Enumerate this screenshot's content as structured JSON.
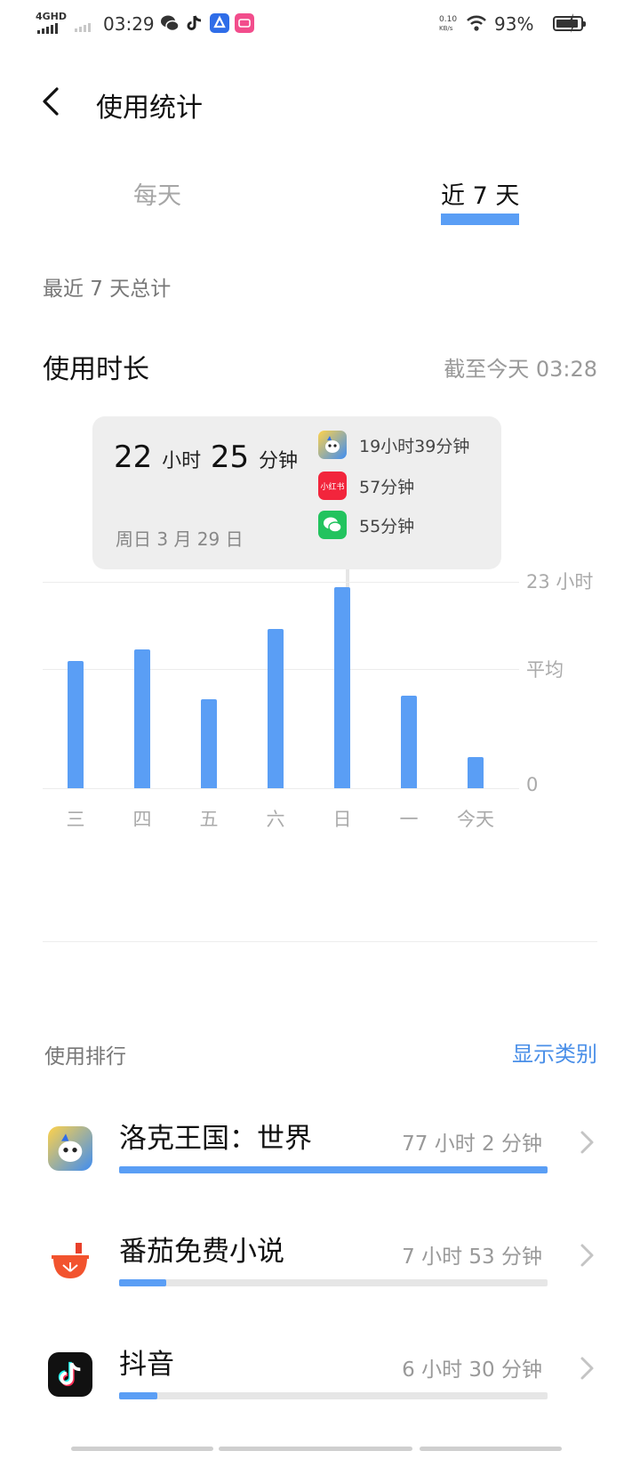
{
  "status_bar": {
    "network": "4GHD",
    "time": "03:29",
    "speed_value": "0.10",
    "speed_unit": "KB/s",
    "battery": "93%",
    "battery_level": 0.93
  },
  "header": {
    "title": "使用统计",
    "back_icon": "chevron-left-icon"
  },
  "tabs": [
    {
      "label": "每天",
      "active": false
    },
    {
      "label": "近 7 天",
      "active": true
    }
  ],
  "summary": {
    "caption": "最近 7 天总计",
    "usage_title": "使用时长",
    "as_of": "截至今天 03:28"
  },
  "tooltip": {
    "total_hours": "22",
    "hours_unit": "小时",
    "total_minutes": "25",
    "minutes_unit": "分钟",
    "date": "周日 3 月 29 日",
    "apps": [
      {
        "icon": "roco-kingdom-icon",
        "time": "19小时39分钟"
      },
      {
        "icon": "xiaohongshu-icon",
        "icon_text": "小红书",
        "time": "57分钟"
      },
      {
        "icon": "wechat-icon",
        "time": "55分钟"
      }
    ]
  },
  "chart_data": {
    "type": "bar",
    "categories": [
      "三",
      "四",
      "五",
      "六",
      "日",
      "一",
      "今天"
    ],
    "values": [
      14.2,
      15.5,
      9.9,
      17.7,
      22.42,
      10.3,
      3.5
    ],
    "ylim": [
      0,
      23
    ],
    "y_tick_labels": [
      "23 小时",
      "平均",
      "0"
    ],
    "average_value": 13.5,
    "highlight_index": 4,
    "color": "#5a9ef5"
  },
  "ranking": {
    "title": "使用排行",
    "show_category": "显示类别",
    "items": [
      {
        "name": "洛克王国：世界",
        "time": "77 小时 2 分钟",
        "share": 1.0,
        "icon": "roco-kingdom-icon"
      },
      {
        "name": "番茄免费小说",
        "time": "7 小时 53 分钟",
        "share": 0.11,
        "icon": "tomato-novel-icon"
      },
      {
        "name": "抖音",
        "time": "6 小时 30 分钟",
        "share": 0.09,
        "icon": "douyin-icon"
      }
    ]
  },
  "colors": {
    "accent": "#5a9ef5",
    "link": "#4a8fe8"
  }
}
